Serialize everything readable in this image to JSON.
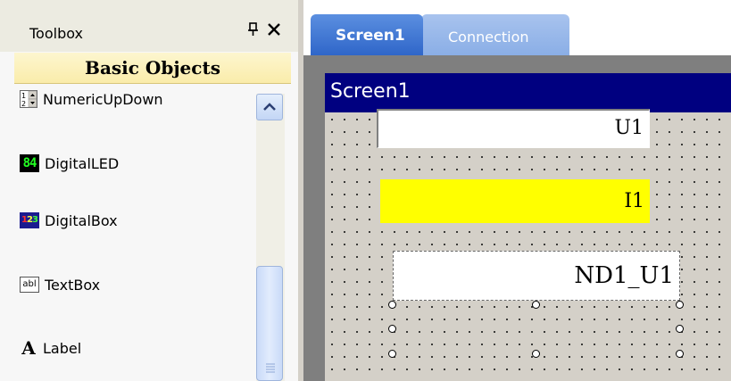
{
  "toolbox": {
    "title": "Toolbox",
    "pin_icon": "pin-icon",
    "close_icon": "close-icon",
    "category": "Basic Objects",
    "items": [
      {
        "label": "NumericUpDown",
        "icon": "numeric-updown-icon"
      },
      {
        "label": "DigitalLED",
        "icon": "digital-led-icon",
        "icon_text": "84"
      },
      {
        "label": "DigitalBox",
        "icon": "digital-box-icon",
        "icon_text": "123"
      },
      {
        "label": "TextBox",
        "icon": "textbox-icon",
        "icon_text": "abl"
      },
      {
        "label": "Label",
        "icon": "label-icon",
        "icon_text": "A"
      }
    ]
  },
  "designer": {
    "tabs": [
      {
        "label": "Screen1",
        "active": true
      },
      {
        "label": "Connection",
        "active": false
      }
    ],
    "screen": {
      "title": "Screen1",
      "header_color": "#000080",
      "objects": [
        {
          "name": "text-object-u1",
          "text": "U1",
          "background": "#ffffff"
        },
        {
          "name": "text-object-i1",
          "text": "I1",
          "background": "#ffff00"
        },
        {
          "name": "numeric-object-nd1-u1",
          "text": "ND1_U1",
          "background": "#ffffff",
          "selected": true
        }
      ]
    }
  }
}
